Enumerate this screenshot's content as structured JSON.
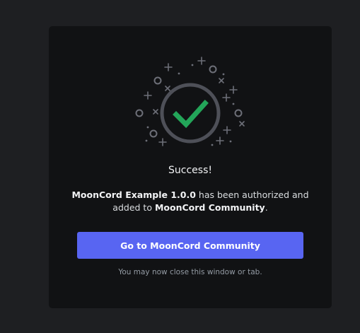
{
  "auth": {
    "title": "Success!",
    "message_app": "MoonCord Example 1.0.0",
    "message_middle": " has been authorized and added to ",
    "message_server": "MoonCord Community",
    "message_end": ".",
    "button_label": "Go to MoonCord Community",
    "footnote": "You may now close this window or tab."
  },
  "colors": {
    "page_bg": "#1e1f22",
    "card_bg": "#111214",
    "accent": "#5865f2",
    "check": "#23a559",
    "ring": "#4e5058",
    "sparkle": "#6d6f78"
  },
  "icons": {
    "check": "checkmark-icon",
    "sparkles": "sparkle-icon"
  }
}
